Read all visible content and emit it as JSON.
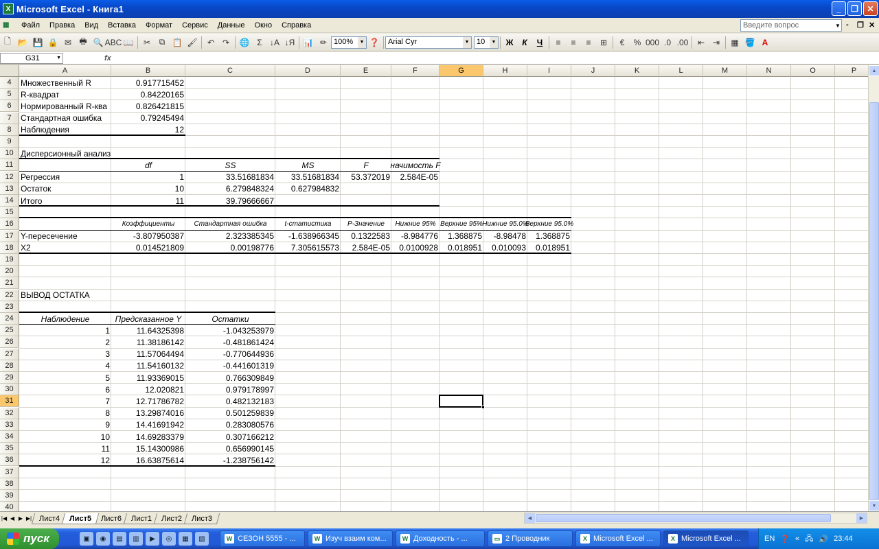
{
  "window": {
    "title": "Microsoft Excel - Книга1"
  },
  "menu": [
    "Файл",
    "Правка",
    "Вид",
    "Вставка",
    "Формат",
    "Сервис",
    "Данные",
    "Окно",
    "Справка"
  ],
  "help_placeholder": "Введите вопрос",
  "toolbar": {
    "zoom": "100%",
    "font": "Arial Cyr",
    "size": "10",
    "bold": "Ж",
    "italic": "К",
    "underline": "Ч"
  },
  "namebox": "G31",
  "fx_label": "fx",
  "columns": [
    "A",
    "B",
    "C",
    "D",
    "E",
    "F",
    "G",
    "H",
    "I",
    "J",
    "K",
    "L",
    "M",
    "N",
    "O",
    "P"
  ],
  "rows": [
    "4",
    "5",
    "6",
    "7",
    "8",
    "9",
    "10",
    "11",
    "12",
    "13",
    "14",
    "15",
    "16",
    "17",
    "18",
    "19",
    "20",
    "21",
    "22",
    "23",
    "24",
    "25",
    "26",
    "27",
    "28",
    "29",
    "30",
    "31",
    "32",
    "33",
    "34",
    "35",
    "36",
    "37",
    "38",
    "39",
    "40"
  ],
  "selected_col": "G",
  "selected_row": "31",
  "stats": {
    "r4a": "Множественный R",
    "r4b": "0.917715452",
    "r5a": "R-квадрат",
    "r5b": "0.84220165",
    "r6a": "Нормированный R-ква",
    "r6b": "0.826421815",
    "r7a": "Стандартная ошибка",
    "r7b": "0.79245494",
    "r8a": "Наблюдения",
    "r8b": "12"
  },
  "anova": {
    "title": "Дисперсионный анализ",
    "h_df": "df",
    "h_ss": "SS",
    "h_ms": "MS",
    "h_f": "F",
    "h_sig": "начимость F",
    "reg": {
      "a": "Регрессия",
      "df": "1",
      "ss": "33.51681834",
      "ms": "33.51681834",
      "f": "53.372019",
      "sig": "2.584E-05"
    },
    "res": {
      "a": "Остаток",
      "df": "10",
      "ss": "6.279848324",
      "ms": "0.627984832"
    },
    "tot": {
      "a": "Итого",
      "df": "11",
      "ss": "39.79666667"
    }
  },
  "coef": {
    "h": [
      "Коэффициенты",
      "Стандартная ошибка",
      "t-статистика",
      "P-Значение",
      "Нижние 95%",
      "Верхние 95%",
      "Нижние 95.0%",
      "Верхние 95.0%"
    ],
    "y": {
      "a": "Y-пересечение",
      "v": [
        "-3.807950387",
        "2.323385345",
        "-1.638966345",
        "0.1322583",
        "-8.984776",
        "1.368875",
        "-8.98478",
        "1.368875"
      ]
    },
    "x2": {
      "a": "X2",
      "v": [
        "0.014521809",
        "0.00198776",
        "7.305615573",
        "2.584E-05",
        "0.0100928",
        "0.018951",
        "0.010093",
        "0.018951"
      ]
    }
  },
  "resid": {
    "title": "ВЫВОД ОСТАТКА",
    "h": [
      "Наблюдение",
      "Предсказанное Y",
      "Остатки"
    ],
    "rows": [
      [
        "1",
        "11.64325398",
        "-1.043253979"
      ],
      [
        "2",
        "11.38186142",
        "-0.481861424"
      ],
      [
        "3",
        "11.57064494",
        "-0.770644936"
      ],
      [
        "4",
        "11.54160132",
        "-0.441601319"
      ],
      [
        "5",
        "11.93369015",
        "0.766309849"
      ],
      [
        "6",
        "12.020821",
        "0.979178997"
      ],
      [
        "7",
        "12.71786782",
        "0.482132183"
      ],
      [
        "8",
        "13.29874016",
        "0.501259839"
      ],
      [
        "9",
        "14.41691942",
        "0.283080576"
      ],
      [
        "10",
        "14.69283379",
        "0.307166212"
      ],
      [
        "11",
        "15.14300986",
        "0.656990145"
      ],
      [
        "12",
        "16.63875614",
        "-1.238756142"
      ]
    ]
  },
  "sheets": [
    "Лист4",
    "Лист5",
    "Лист6",
    "Лист1",
    "Лист2",
    "Лист3"
  ],
  "active_sheet": "Лист5",
  "taskbar": {
    "start": "пуск",
    "tasks": [
      "СЕЗОН 5555 - ...",
      "Изуч взаим ком...",
      "Доходность - ...",
      "2 Проводник",
      "Microsoft Excel ...",
      "Microsoft Excel ..."
    ],
    "lang": "EN",
    "clock": "23:44"
  }
}
